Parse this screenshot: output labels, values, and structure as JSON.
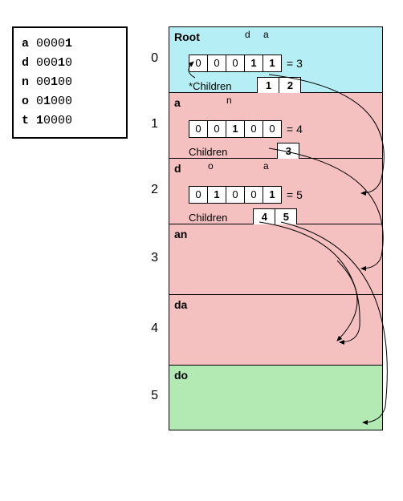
{
  "legend": [
    {
      "char": "a",
      "bits": "00001"
    },
    {
      "char": "d",
      "bits": "00010"
    },
    {
      "char": "n",
      "bits": "00100"
    },
    {
      "char": "o",
      "bits": "01000"
    },
    {
      "char": "t",
      "bits": "10000"
    }
  ],
  "indices": [
    "0",
    "1",
    "2",
    "3",
    "4",
    "5"
  ],
  "nodes": [
    {
      "id": "root",
      "title": "Root",
      "color": "cyan",
      "bit_labels": [
        {
          "pos": 3,
          "t": "d"
        },
        {
          "pos": 4,
          "t": "a"
        }
      ],
      "bits": [
        "0",
        "0",
        "0",
        "1",
        "1"
      ],
      "sum": "= 3",
      "children_label": "*Children",
      "children": [
        "1",
        "2"
      ]
    },
    {
      "id": "a",
      "title": "a",
      "color": "pink",
      "bit_labels": [
        {
          "pos": 2,
          "t": "n"
        }
      ],
      "bits": [
        "0",
        "0",
        "1",
        "0",
        "0"
      ],
      "sum": "= 4",
      "children_label": "Children",
      "children": [
        "3"
      ]
    },
    {
      "id": "d",
      "title": "d",
      "color": "pink",
      "bit_labels": [
        {
          "pos": 1,
          "t": "o"
        },
        {
          "pos": 4,
          "t": "a"
        }
      ],
      "bits": [
        "0",
        "1",
        "0",
        "0",
        "1"
      ],
      "sum": "= 5",
      "children_label": "Children",
      "children": [
        "4",
        "5"
      ]
    },
    {
      "id": "an",
      "title": "an",
      "color": "pink",
      "leaf": true
    },
    {
      "id": "da",
      "title": "da",
      "color": "pink",
      "leaf": true
    },
    {
      "id": "do",
      "title": "do",
      "color": "green",
      "leaf": true
    }
  ]
}
